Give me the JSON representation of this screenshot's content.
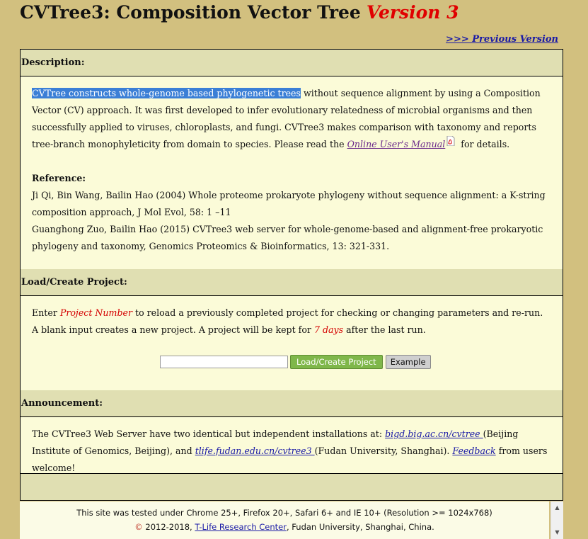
{
  "header": {
    "title": "CVTree3: Composition Vector Tree",
    "version": "Version 3",
    "prev_link": ">>> Previous Version"
  },
  "description": {
    "heading": "Description:",
    "highlighted": "CVTree constructs whole-genome based phylogenetic trees",
    "text1": " without sequence alignment by using a Composition Vector (CV) approach. It was first developed to infer evolutionary relatedness of microbial organisms and then successfully applied to viruses, chloroplasts, and fungi. CVTree3 makes comparison with taxonomy and reports tree-branch monophyleticity from domain to species. Please read the ",
    "manual_link": "Online User's Manual",
    "text2": " for details.",
    "ref_heading": "Reference:",
    "ref1": "Ji Qi, Bin Wang, Bailin Hao (2004) Whole proteome prokaryote phylogeny without sequence alignment: a K-string composition approach, J Mol Evol, 58: 1 –11",
    "ref2": "Guanghong Zuo, Bailin Hao (2015) CVTree3 web server for whole-genome-based and alignment-free prokaryotic phylogeny and taxonomy, Genomics Proteomics & Bioinformatics, 13: 321-331."
  },
  "project": {
    "heading": "Load/Create Project:",
    "t1": "Enter ",
    "project_number": "Project Number",
    "t2": " to reload a previously completed project for checking or changing parameters and re-run. A blank input creates a new project. A project will be kept for ",
    "days": "7 days",
    "t3": " after the last run.",
    "input_value": "",
    "load_button": "Load/Create Project",
    "example_button": "Example"
  },
  "announcement": {
    "heading": "Announcement:",
    "t1": "The CVTree3 Web Server have two identical but independent installations at: ",
    "link1": "bigd.big.ac.cn/cvtree ",
    "t2": "(Beijing Institute of Genomics, Beijing), and ",
    "link2": "tlife.fudan.edu.cn/cvtree3 ",
    "t3": "(Fudan University, Shanghai). ",
    "feedback": "Feedback",
    "t4": " from users welcome!"
  },
  "footer": {
    "line1": "This site was tested under Chrome 25+, Firefox 20+, Safari 6+ and IE 10+ (Resolution >= 1024x768)",
    "copyright_symbol": "©",
    "years": " 2012-2018, ",
    "center_link": "T-Life Research Center",
    "line2_tail": ", Fudan University, Shanghai, China."
  },
  "icons": {
    "pdf": "pdf-icon",
    "scroll_up": "scroll-up-icon",
    "scroll_down": "scroll-down-icon"
  }
}
